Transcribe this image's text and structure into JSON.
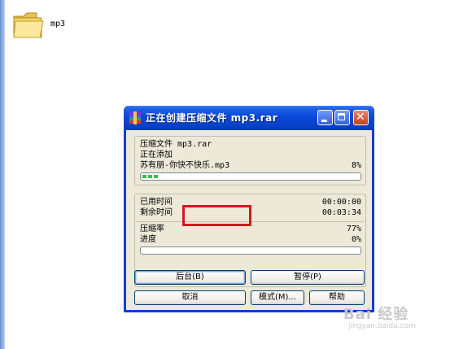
{
  "desktop": {
    "folder": {
      "label": "mp3",
      "icon": "folder-icon"
    }
  },
  "window": {
    "title": "正在创建压缩文件 mp3.rar",
    "app_icon": "winrar-icon",
    "controls": {
      "minimize_icon": "minimize-icon",
      "maximize_icon": "maximize-icon",
      "close_icon": "close-icon"
    }
  },
  "status": {
    "archive_line": "压缩文件 mp3.rar",
    "action_line": "正在添加",
    "file_name": "苏有朋-你快不快乐.mp3",
    "file_percent": "8%",
    "file_progress": 0.08
  },
  "stats": {
    "elapsed_label": "已用时间",
    "elapsed_value": "00:00:00",
    "remaining_label": "剩余时间",
    "remaining_value": "00:03:34",
    "ratio_label": "压缩率",
    "ratio_value": "77%",
    "progress_label": "进度",
    "progress_value": "0%",
    "overall_progress": 0.0
  },
  "buttons": {
    "background": "后台(B)",
    "pause": "暂停(P)",
    "cancel": "取消",
    "mode": "模式(M)...",
    "help": "帮助"
  },
  "watermark": {
    "logo": "Bai 经验",
    "url": "jingyan.baidu.com"
  },
  "colors": {
    "titlebar": "#0a48d8",
    "highlight": "#d8151c",
    "progress_fill": "#2cc34b",
    "dialog_bg": "#ece9d8"
  }
}
